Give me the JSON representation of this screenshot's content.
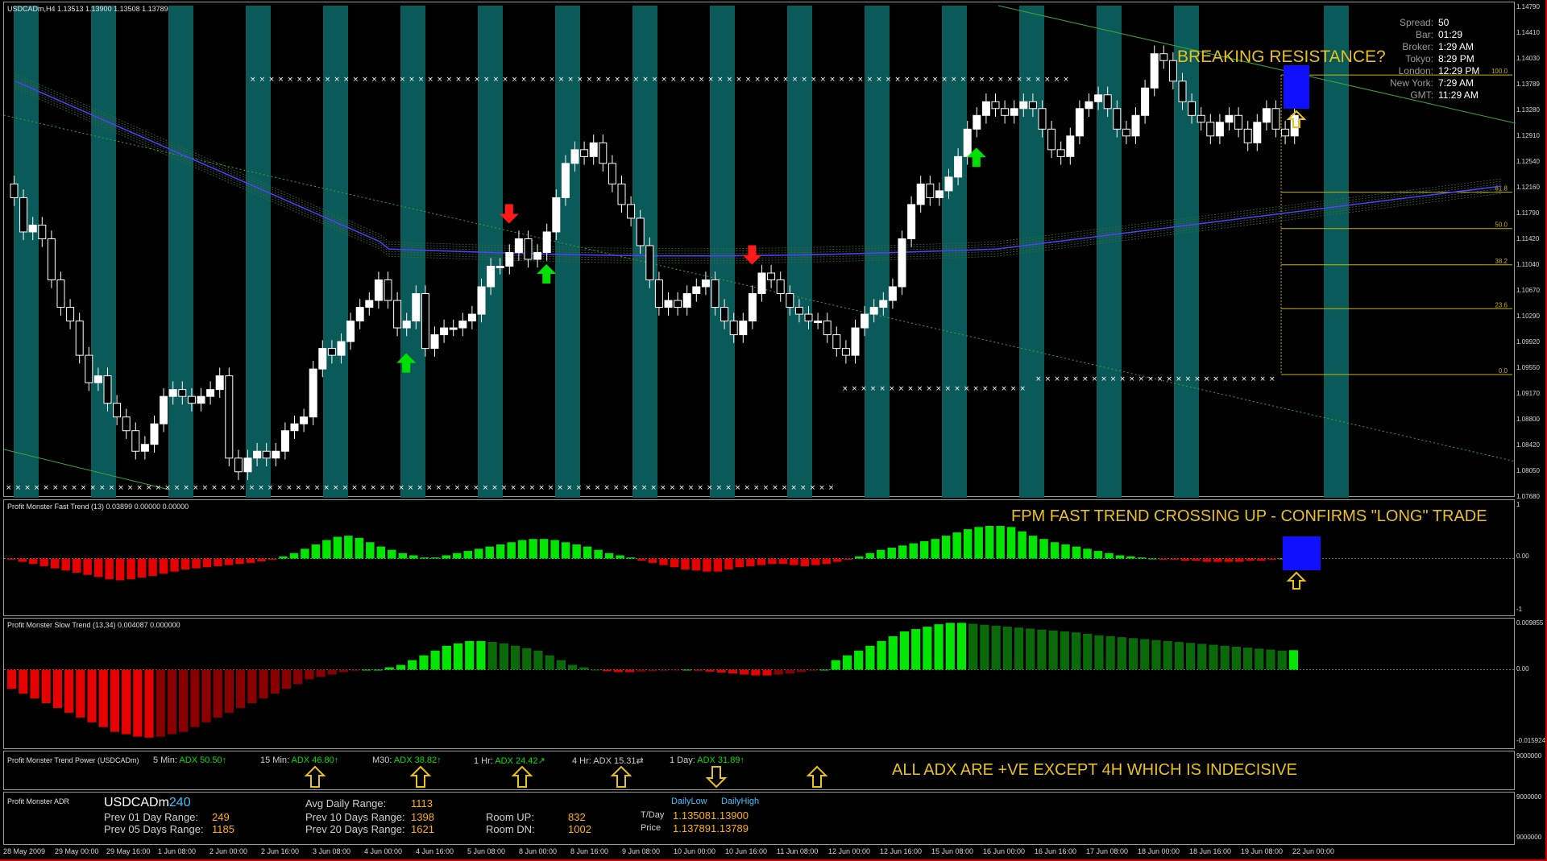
{
  "main": {
    "title": "USDCADm,H4  1.13513 1.13900 1.13508 1.13789",
    "y_ticks": [
      "1.14790",
      "1.14410",
      "1.14030",
      "1.13789",
      "1.13280",
      "1.12910",
      "1.12540",
      "1.12160",
      "1.11790",
      "1.11420",
      "1.11040",
      "1.10670",
      "1.10290",
      "1.09920",
      "1.09550",
      "1.09170",
      "1.08800",
      "1.08420",
      "1.08050",
      "1.07680"
    ],
    "annotation": "BREAKING RESISTANCE?",
    "info": [
      {
        "label": "Spread:",
        "value": "50"
      },
      {
        "label": "Bar:",
        "value": "01:29"
      },
      {
        "label": "Broker:",
        "value": "1:29 AM"
      },
      {
        "label": "Tokyo:",
        "value": "8:29 PM"
      },
      {
        "label": "London:",
        "value": "12:29 PM"
      },
      {
        "label": "New York:",
        "value": "7:29 AM"
      },
      {
        "label": "GMT:",
        "value": "11:29 AM"
      }
    ],
    "fib_levels": [
      {
        "label": "100.0",
        "price": 1.13789
      },
      {
        "label": "61.8",
        "price": 1.1208
      },
      {
        "label": "50.0",
        "price": 1.1155
      },
      {
        "label": "38.2",
        "price": 1.1102
      },
      {
        "label": "23.6",
        "price": 1.1038
      },
      {
        "label": "0.0",
        "price": 1.0942
      }
    ]
  },
  "fast_trend": {
    "title": "Profit Monster Fast Trend (13) 0.03899 0.00000 0.00000",
    "annotation": "FPM FAST TREND CROSSING UP - CONFIRMS \"LONG\" TRADE",
    "y_ticks": [
      "1",
      "0.00",
      "-1"
    ]
  },
  "slow_trend": {
    "title": "Profit Monster Slow Trend (13,34) 0.004087 0.000000",
    "y_ticks": [
      "0.009855",
      "0.00",
      "-0.015924"
    ]
  },
  "trend_power": {
    "title": "Profit Monster Trend Power (USDCADm)",
    "annotation": "ALL ADX ARE +VE EXCEPT 4H WHICH IS INDECISIVE",
    "y_tick": "9000000",
    "items": [
      {
        "tf": "5 Min:",
        "adx": "ADX 50.50",
        "dir": "↑"
      },
      {
        "tf": "15 Min:",
        "adx": "ADX 46.80",
        "dir": "↑"
      },
      {
        "tf": "M30:",
        "adx": "ADX 38.82",
        "dir": "↑"
      },
      {
        "tf": "1 Hr:",
        "adx": "ADX 24.42",
        "dir": "↗"
      },
      {
        "tf": "4 Hr:",
        "adx": "ADX 15.31",
        "dir": "⇄"
      },
      {
        "tf": "1 Day:",
        "adx": "ADX 31.89",
        "dir": "↑"
      }
    ]
  },
  "adr": {
    "title": "Profit Monster ADR",
    "symbol": "USDCADm",
    "period": "240",
    "prev01_label": "Prev 01 Day Range:",
    "prev01": "249",
    "prev05_label": "Prev 05 Days Range:",
    "prev05": "1185",
    "avg_label": "Avg Daily Range:",
    "avg": "1113",
    "prev10_label": "Prev 10 Days Range:",
    "prev10": "1398",
    "prev20_label": "Prev 20 Days Range:",
    "prev20": "1621",
    "roomup_label": "Room UP:",
    "roomup": "832",
    "roomdn_label": "Room DN:",
    "roomdn": "1002",
    "dailylow_label": "DailyLow",
    "dailyhigh_label": "DailyHigh",
    "tday_label": "T/Day",
    "tday_low": "1.13508",
    "tday_high": "1.13900",
    "price_label": "Price",
    "price_bid": "1.13789",
    "price_ask": "1.13789",
    "y_tick_top": "9000000",
    "y_tick_bottom": "9000000"
  },
  "x_axis": [
    "28 May 2009",
    "29 May 00:00",
    "29 May 16:00",
    "1 Jun 08:00",
    "2 Jun 00:00",
    "2 Jun 16:00",
    "3 Jun 08:00",
    "4 Jun 00:00",
    "4 Jun 16:00",
    "5 Jun 08:00",
    "8 Jun 00:00",
    "8 Jun 16:00",
    "9 Jun 08:00",
    "10 Jun 00:00",
    "10 Jun 16:00",
    "11 Jun 08:00",
    "12 Jun 00:00",
    "12 Jun 16:00",
    "15 Jun 08:00",
    "16 Jun 00:00",
    "16 Jun 16:00",
    "17 Jun 08:00",
    "18 Jun 00:00",
    "18 Jun 16:00",
    "19 Jun 08:00",
    "22 Jun 00:00"
  ],
  "colors": {
    "teal_band": "#0b5a5a",
    "up_arrow": "#00e000",
    "down_arrow": "#ff1a1a",
    "hist_green": "#00e600",
    "hist_red": "#e60000",
    "hist_dark_green": "#0a6a0a",
    "hist_dark_red": "#8a0000",
    "highlight": "#1010ff",
    "annotation": "#e8c21a"
  },
  "chart_data": [
    {
      "type": "candlestick",
      "title": "USDCADm,H4  1.13513 1.13900 1.13508 1.13789",
      "ylim": [
        1.0768,
        1.1479
      ],
      "bar_count": 160,
      "close": [
        1.12,
        1.115,
        1.116,
        1.114,
        1.108,
        1.104,
        1.102,
        1.097,
        1.093,
        1.094,
        1.09,
        1.088,
        1.086,
        1.083,
        1.084,
        1.087,
        1.091,
        1.092,
        1.091,
        1.09,
        1.091,
        1.092,
        1.094,
        1.082,
        1.08,
        1.082,
        1.083,
        1.082,
        1.083,
        1.086,
        1.087,
        1.088,
        1.095,
        1.098,
        1.097,
        1.099,
        1.102,
        1.104,
        1.105,
        1.108,
        1.105,
        1.101,
        1.102,
        1.106,
        1.098,
        1.1,
        1.101,
        1.101,
        1.102,
        1.103,
        1.107,
        1.11,
        1.11,
        1.112,
        1.114,
        1.111,
        1.112,
        1.115,
        1.12,
        1.125,
        1.127,
        1.126,
        1.128,
        1.125,
        1.122,
        1.119,
        1.117,
        1.113,
        1.108,
        1.104,
        1.105,
        1.104,
        1.106,
        1.107,
        1.108,
        1.104,
        1.102,
        1.1,
        1.102,
        1.106,
        1.109,
        1.108,
        1.106,
        1.104,
        1.103,
        1.102,
        1.102,
        1.1,
        1.098,
        1.097,
        1.101,
        1.103,
        1.104,
        1.105,
        1.107,
        1.114,
        1.119,
        1.122,
        1.12,
        1.121,
        1.123,
        1.126,
        1.13,
        1.132,
        1.134,
        1.133,
        1.132,
        1.133,
        1.134,
        1.133,
        1.13,
        1.127,
        1.126,
        1.129,
        1.133,
        1.134,
        1.135,
        1.133,
        1.13,
        1.129,
        1.132,
        1.136,
        1.141,
        1.14,
        1.137,
        1.134,
        1.132,
        1.131,
        1.129,
        1.131,
        1.132,
        1.13,
        1.128,
        1.131,
        1.133,
        1.13,
        1.129,
        1.132,
        1.131,
        1.13,
        1.129,
        1.127,
        1.131,
        1.134,
        1.135,
        1.137,
        1.1379,
        1.1379,
        1.1379,
        1.1379,
        1.1379,
        1.1379,
        1.1379,
        1.1379,
        1.1379,
        1.1379,
        1.1379,
        1.1379,
        1.1379,
        1.1379,
        1.1379,
        1.1379
      ],
      "up_signals": [
        42,
        57,
        103,
        159
      ],
      "down_signals": [
        53,
        79
      ]
    },
    {
      "type": "bar",
      "title": "Profit Monster Fast Trend (13) 0.03899 0.00000 0.00000",
      "ylim": [
        -1,
        1
      ],
      "values": [
        -0.02,
        -0.06,
        -0.1,
        -0.14,
        -0.18,
        -0.22,
        -0.26,
        -0.3,
        -0.34,
        -0.38,
        -0.4,
        -0.38,
        -0.35,
        -0.32,
        -0.28,
        -0.24,
        -0.2,
        -0.18,
        -0.16,
        -0.14,
        -0.12,
        -0.1,
        -0.08,
        -0.05,
        -0.02,
        0.04,
        0.1,
        0.18,
        0.26,
        0.34,
        0.4,
        0.42,
        0.38,
        0.3,
        0.22,
        0.16,
        0.1,
        0.06,
        0.02,
        0.02,
        0.06,
        0.1,
        0.14,
        0.18,
        0.22,
        0.26,
        0.3,
        0.34,
        0.36,
        0.36,
        0.34,
        0.3,
        0.26,
        0.22,
        0.16,
        0.1,
        0.06,
        0.02,
        -0.04,
        -0.08,
        -0.12,
        -0.16,
        -0.2,
        -0.22,
        -0.24,
        -0.24,
        -0.2,
        -0.16,
        -0.14,
        -0.12,
        -0.1,
        -0.1,
        -0.12,
        -0.14,
        -0.12,
        -0.1,
        -0.06,
        -0.02,
        0.04,
        0.1,
        0.16,
        0.2,
        0.24,
        0.28,
        0.32,
        0.36,
        0.42,
        0.48,
        0.54,
        0.58,
        0.6,
        0.6,
        0.58,
        0.5,
        0.42,
        0.36,
        0.3,
        0.26,
        0.22,
        0.18,
        0.14,
        0.1,
        0.06,
        0.04,
        0.02,
        0.0,
        -0.02,
        -0.02,
        -0.04,
        -0.04,
        -0.06,
        -0.06,
        -0.06,
        -0.06,
        -0.04,
        -0.04,
        -0.02,
        0.0,
        0.039
      ],
      "series_colors": "green when rising above 0, red when below 0"
    },
    {
      "type": "bar",
      "title": "Profit Monster Slow Trend (13,34) 0.004087 0.000000",
      "ylim": [
        -0.015924,
        0.009855
      ],
      "values": [
        -0.004,
        -0.005,
        -0.006,
        -0.007,
        -0.008,
        -0.009,
        -0.01,
        -0.011,
        -0.012,
        -0.013,
        -0.0135,
        -0.014,
        -0.0142,
        -0.014,
        -0.0135,
        -0.013,
        -0.012,
        -0.011,
        -0.01,
        -0.009,
        -0.008,
        -0.007,
        -0.006,
        -0.005,
        -0.004,
        -0.003,
        -0.002,
        -0.0015,
        -0.001,
        -0.0005,
        -0.0002,
        0.0,
        0.0,
        0.0005,
        0.001,
        0.002,
        0.003,
        0.004,
        0.005,
        0.0055,
        0.006,
        0.006,
        0.0058,
        0.0055,
        0.005,
        0.0045,
        0.004,
        0.003,
        0.002,
        0.001,
        0.0005,
        0.0,
        -0.0003,
        -0.0005,
        -0.0005,
        -0.0004,
        -0.0003,
        -0.0002,
        -0.0001,
        0.0,
        -0.0002,
        -0.0004,
        -0.0006,
        -0.0008,
        -0.001,
        -0.0012,
        -0.0012,
        -0.001,
        -0.0008,
        -0.0005,
        -0.0002,
        0.0,
        0.002,
        0.003,
        0.004,
        0.005,
        0.006,
        0.007,
        0.008,
        0.0085,
        0.009,
        0.0095,
        0.0098,
        0.0098,
        0.0096,
        0.0094,
        0.0092,
        0.009,
        0.0088,
        0.0086,
        0.0084,
        0.0082,
        0.008,
        0.0078,
        0.0075,
        0.0072,
        0.007,
        0.0068,
        0.0066,
        0.0064,
        0.0062,
        0.006,
        0.0058,
        0.0056,
        0.0054,
        0.0052,
        0.005,
        0.0048,
        0.0046,
        0.0044,
        0.0042,
        0.004,
        0.004087
      ]
    }
  ]
}
